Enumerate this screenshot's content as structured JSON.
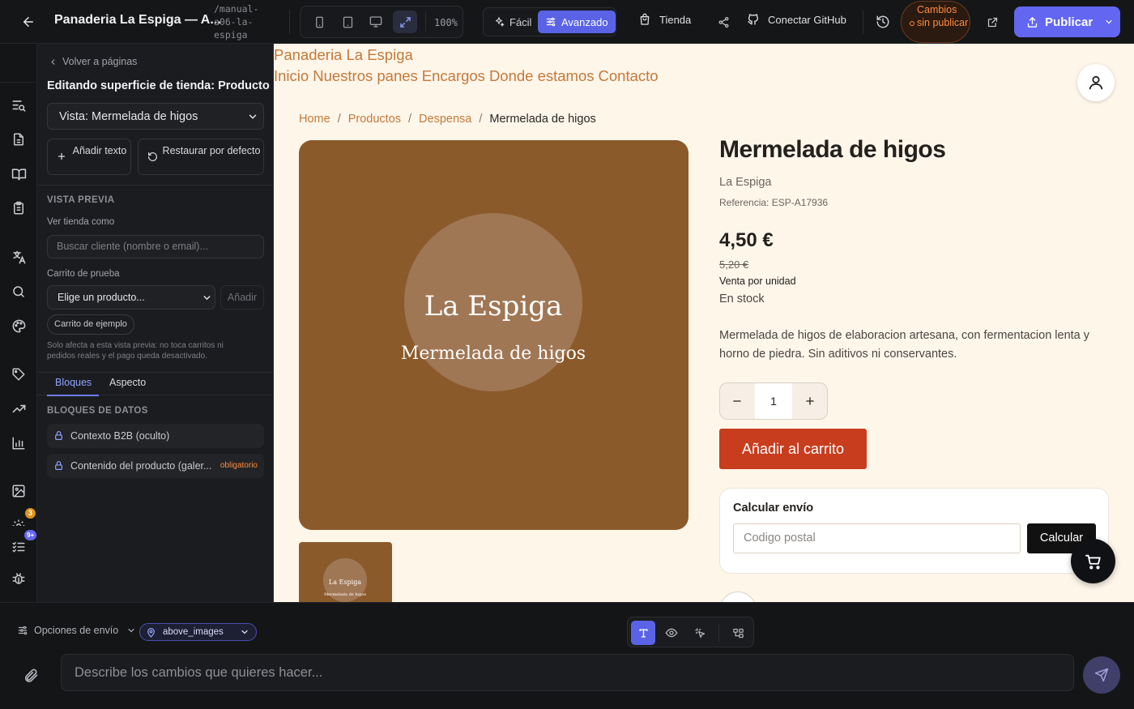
{
  "topbar": {
    "project_title": "Panaderia La Espiga — A...",
    "project_slug": "/manual-a06-la-espiga",
    "zoom": "100%",
    "modes": {
      "easy": "Fácil",
      "advanced": "Avanzado"
    },
    "store_link": "Tienda",
    "github_link": "Conectar GitHub",
    "unsaved": "Cambios sin publicar",
    "publish": "Publicar"
  },
  "rail": {
    "badges": {
      "first": "3",
      "second": "9+"
    }
  },
  "panel": {
    "back": "Volver a páginas",
    "title": "Editando superficie de tienda: Producto",
    "view_select": "Vista: Mermelada de higos",
    "add_text": "Añadir texto",
    "restore": "Restaurar por defecto",
    "preview_section": "VISTA PREVIA",
    "view_as_label": "Ver tienda como",
    "customer_placeholder": "Buscar cliente (nombre o email)...",
    "test_cart_label": "Carrito de prueba",
    "product_select": "Elige un producto...",
    "add_button": "Añadir",
    "sample_cart": "Carrito de ejemplo",
    "note": "Solo afecta a esta vista previa: no toca carritos ni pedidos reales y el pago queda desactivado.",
    "tabs": [
      "Bloques",
      "Aspecto"
    ],
    "data_blocks_section": "BLOQUES DE DATOS",
    "blocks": [
      {
        "label": "Contexto B2B (oculto)",
        "tag": ""
      },
      {
        "label": "Contenido del producto (galer...",
        "tag": "obligatorio"
      }
    ]
  },
  "preview": {
    "store_name": "Panaderia La Espiga",
    "nav": [
      "Inicio",
      "Nuestros panes",
      "Encargos",
      "Donde estamos",
      "Contacto"
    ],
    "breadcrumbs": [
      "Home",
      "Productos",
      "Despensa",
      "Mermelada de higos"
    ],
    "image_brand": "La Espiga",
    "image_product": "Mermelada de higos",
    "product": {
      "title": "Mermelada de higos",
      "brand": "La Espiga",
      "reference": "Referencia: ESP-A17936",
      "price": "4,50 €",
      "old_price": "5,20 €",
      "unit": "Venta por unidad",
      "stock": "En stock",
      "description": "Mermelada de higos de elaboracion artesana, con fermentacion lenta y horno de piedra. Sin aditivos ni conservantes.",
      "quantity": "1",
      "add_to_cart": "Añadir al carrito"
    },
    "shipping": {
      "title": "Calcular envío",
      "placeholder": "Codigo postal",
      "button": "Calcular"
    },
    "colors": {
      "background": "#fff6ea",
      "accent": "#c3793a",
      "image": "#8b5a2b",
      "cta": "#c73d1e"
    }
  },
  "bottom": {
    "send_options": "Opciones de envío",
    "location": "above_images",
    "chat_placeholder": "Describe los cambios que quieres hacer..."
  }
}
